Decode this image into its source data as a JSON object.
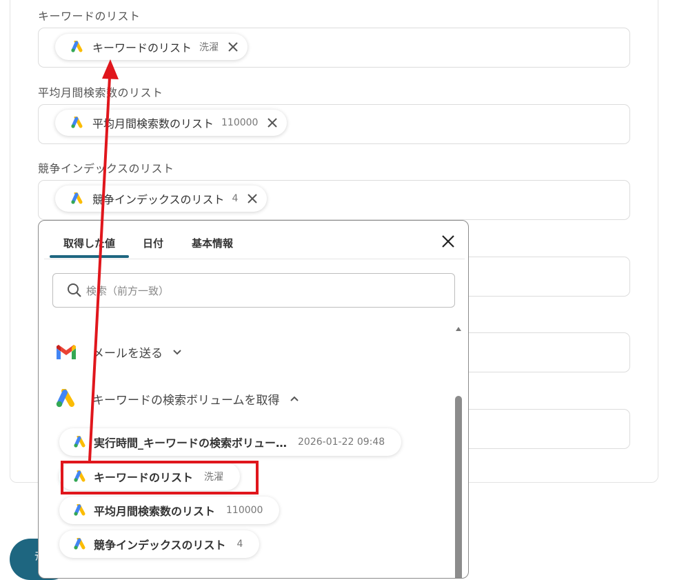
{
  "form": {
    "keyword_list": {
      "label": "キーワードのリスト",
      "chip_name": "キーワードのリスト",
      "chip_value": "洗濯"
    },
    "avg_search": {
      "label": "平均月間検索数のリスト",
      "chip_name": "平均月間検索数のリスト",
      "chip_value": "110000"
    },
    "competition": {
      "label": "競争インデックスのリスト",
      "chip_name": "競争インデックスのリスト",
      "chip_value": "4"
    }
  },
  "panel": {
    "tabs": [
      "取得した値",
      "日付",
      "基本情報"
    ],
    "search_placeholder": "検索（前方一致）",
    "sections": [
      {
        "title": "メールを送る",
        "icon": "gmail-icon",
        "expanded": false
      },
      {
        "title": "キーワードの検索ボリュームを取得",
        "icon": "google-ads-icon",
        "expanded": true
      }
    ],
    "items": [
      {
        "name": "実行時間_キーワードの検索ボリュー…",
        "value": "2026-01-22 09:48"
      },
      {
        "name": "キーワードのリスト",
        "value": "洗濯"
      },
      {
        "name": "平均月間検索数のリスト",
        "value": "110000"
      },
      {
        "name": "競争インデックスのリスト",
        "value": "4"
      }
    ]
  },
  "save_button": {
    "label": "ﾃ"
  },
  "colors": {
    "accent": "#1e6680",
    "annotation": "#e0161c"
  }
}
